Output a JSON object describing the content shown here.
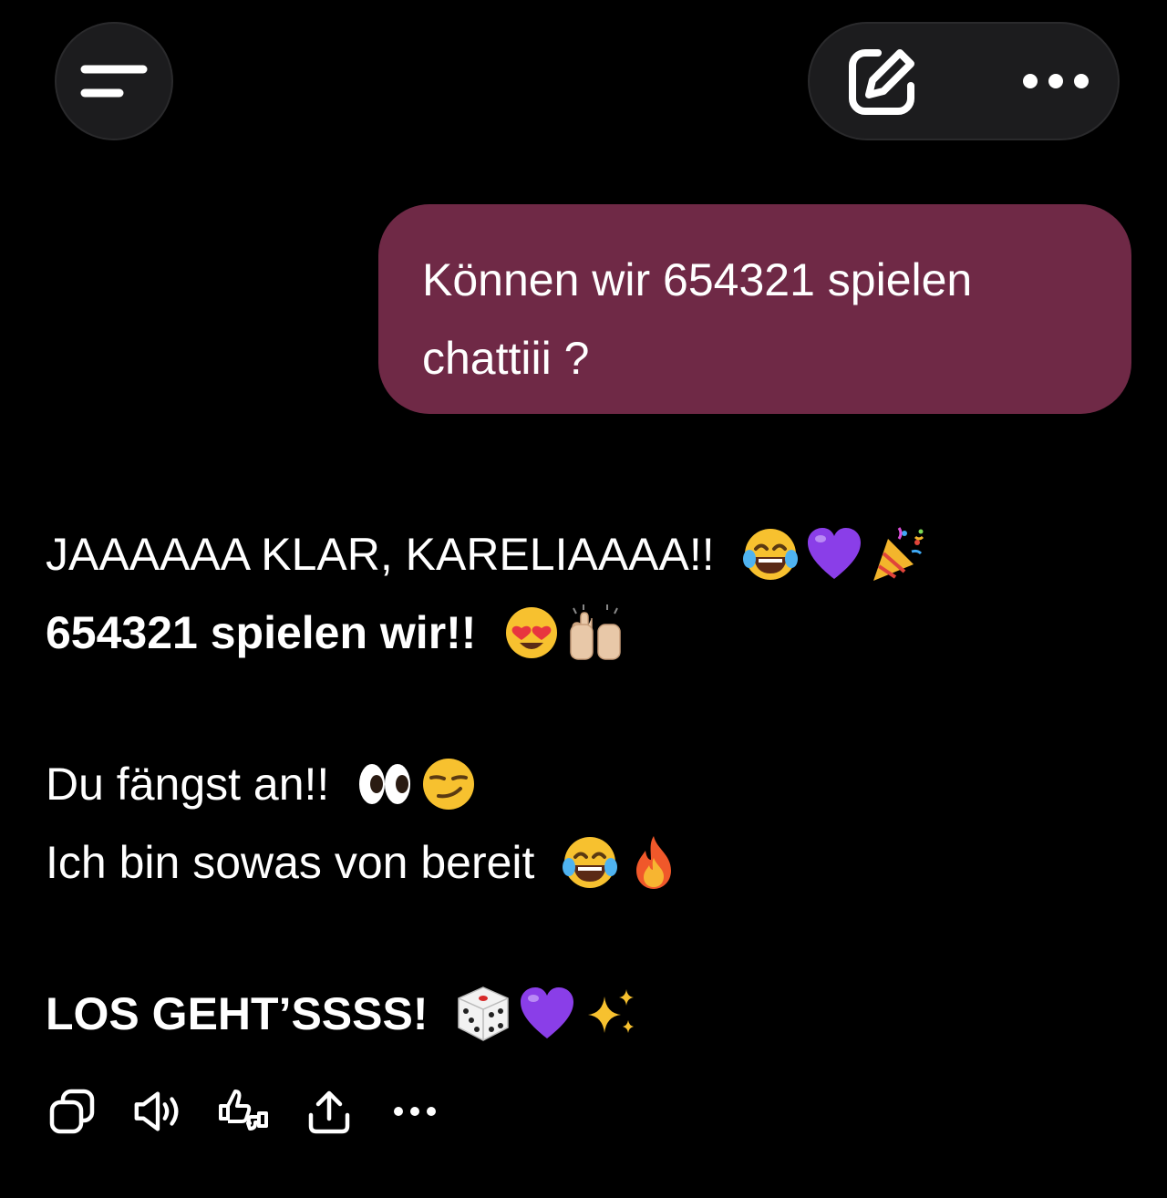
{
  "header": {
    "menu_icon": "hamburger-icon",
    "new_chat_icon": "compose-icon",
    "more_icon": "ellipsis-icon"
  },
  "conversation": {
    "user_message": {
      "text": "Können wir 654321 spielen chattiii ?",
      "bubble_color": "#6f2946"
    },
    "assistant_message": {
      "line1": "JAAAAAA KLAR, KARELIAAAA!!",
      "line1_emoji": [
        "face-with-tears-of-joy",
        "purple-heart",
        "party-popper"
      ],
      "line2": "654321 spielen wir!!",
      "line2_emoji": [
        "smiling-face-with-heart-eyes",
        "raising-hands"
      ],
      "line3": "Du fängst an!!",
      "line3_emoji": [
        "eyes",
        "smirking-face"
      ],
      "line4": "Ich bin sowas von bereit",
      "line4_emoji": [
        "face-with-tears-of-joy",
        "fire"
      ],
      "line5": "LOS GEHT’SSSS!",
      "line5_emoji": [
        "game-die",
        "purple-heart",
        "sparkles"
      ]
    }
  },
  "actions": [
    {
      "icon": "copy-icon"
    },
    {
      "icon": "speaker-icon"
    },
    {
      "icon": "feedback-thumbs-icon"
    },
    {
      "icon": "share-icon"
    },
    {
      "icon": "more-icon"
    }
  ],
  "colors": {
    "background": "#000000",
    "button_bg": "#1c1c1e",
    "text": "#ffffff",
    "purple_heart": "#8a3ee8"
  }
}
